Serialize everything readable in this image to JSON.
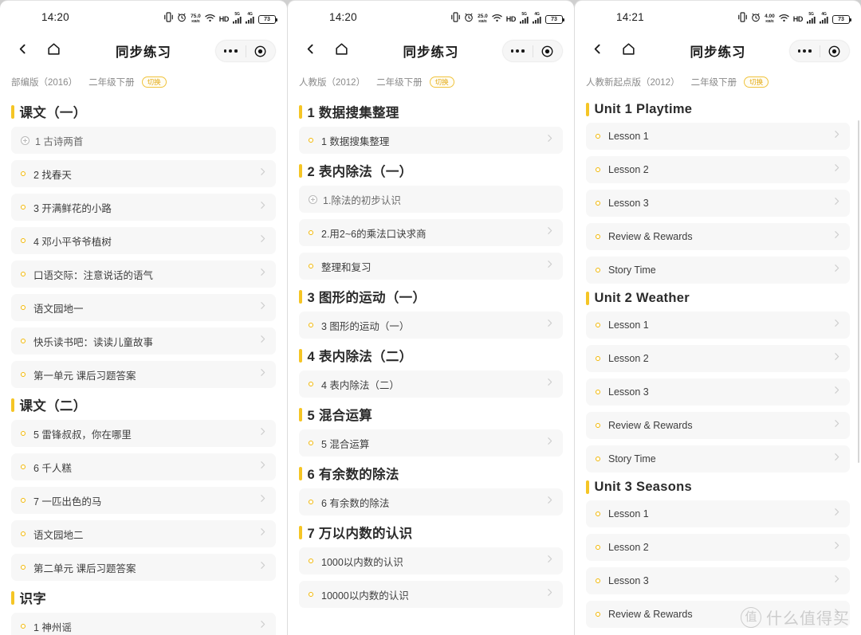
{
  "panels": [
    {
      "status": {
        "time": "14:20",
        "net_speed": "75.0",
        "net_unit": "KB/S",
        "hd_label": "HD",
        "signal1": "5G",
        "signal2": "4G",
        "battery": "73"
      },
      "nav": {
        "title": "同步练习",
        "back_icon": "chevron-left-icon",
        "home_icon": "home-icon",
        "more_icon": "more-dots-icon",
        "target_icon": "target-icon"
      },
      "meta": {
        "book": "部编版（2016）",
        "grade": "二年级下册",
        "switch_label": "切换"
      },
      "sections": [
        {
          "title": "课文（一）",
          "items": [
            {
              "label": "1 古诗两首",
              "state": "loading",
              "chevron": false
            },
            {
              "label": "2 找春天",
              "state": "normal",
              "chevron": true
            },
            {
              "label": "3 开满鲜花的小路",
              "state": "normal",
              "chevron": true
            },
            {
              "label": "4 邓小平爷爷植树",
              "state": "normal",
              "chevron": true
            },
            {
              "label": "口语交际：注意说话的语气",
              "state": "normal",
              "chevron": true
            },
            {
              "label": "语文园地一",
              "state": "normal",
              "chevron": true
            },
            {
              "label": "快乐读书吧：读读儿童故事",
              "state": "normal",
              "chevron": true
            },
            {
              "label": "第一单元 课后习题答案",
              "state": "normal",
              "chevron": true
            }
          ]
        },
        {
          "title": "课文（二）",
          "items": [
            {
              "label": "5 雷锋叔叔，你在哪里",
              "state": "normal",
              "chevron": true
            },
            {
              "label": "6 千人糕",
              "state": "normal",
              "chevron": true
            },
            {
              "label": "7 一匹出色的马",
              "state": "normal",
              "chevron": true
            },
            {
              "label": "语文园地二",
              "state": "normal",
              "chevron": true
            },
            {
              "label": "第二单元 课后习题答案",
              "state": "normal",
              "chevron": true
            }
          ]
        },
        {
          "title": "识字",
          "items": [
            {
              "label": "1 神州谣",
              "state": "normal",
              "chevron": true
            }
          ]
        }
      ]
    },
    {
      "status": {
        "time": "14:20",
        "net_speed": "25.0",
        "net_unit": "KB/S",
        "hd_label": "HD",
        "signal1": "5G",
        "signal2": "4G",
        "battery": "73"
      },
      "nav": {
        "title": "同步练习",
        "back_icon": "chevron-left-icon",
        "home_icon": "home-icon",
        "more_icon": "more-dots-icon",
        "target_icon": "target-icon"
      },
      "meta": {
        "book": "人教版（2012）",
        "grade": "二年级下册",
        "switch_label": "切换"
      },
      "sections": [
        {
          "title": "1 数据搜集整理",
          "items": [
            {
              "label": "1 数据搜集整理",
              "state": "normal",
              "chevron": true
            }
          ]
        },
        {
          "title": "2 表内除法（一）",
          "items": [
            {
              "label": "1.除法的初步认识",
              "state": "loading",
              "chevron": false
            },
            {
              "label": "2.用2~6的乘法口诀求商",
              "state": "normal",
              "chevron": true
            },
            {
              "label": "整理和复习",
              "state": "normal",
              "chevron": true
            }
          ]
        },
        {
          "title": "3 图形的运动（一）",
          "items": [
            {
              "label": "3 图形的运动（一）",
              "state": "normal",
              "chevron": true
            }
          ]
        },
        {
          "title": "4 表内除法（二）",
          "items": [
            {
              "label": "4 表内除法（二）",
              "state": "normal",
              "chevron": true
            }
          ]
        },
        {
          "title": "5 混合运算",
          "items": [
            {
              "label": "5 混合运算",
              "state": "normal",
              "chevron": true
            }
          ]
        },
        {
          "title": "6 有余数的除法",
          "items": [
            {
              "label": "6 有余数的除法",
              "state": "normal",
              "chevron": true
            }
          ]
        },
        {
          "title": "7 万以内数的认识",
          "items": [
            {
              "label": "1000以内数的认识",
              "state": "normal",
              "chevron": true
            },
            {
              "label": "10000以内数的认识",
              "state": "normal",
              "chevron": true
            }
          ]
        }
      ]
    },
    {
      "status": {
        "time": "14:21",
        "net_speed": "4.00",
        "net_unit": "KB/S",
        "hd_label": "HD",
        "signal1": "5G",
        "signal2": "4G",
        "battery": "73"
      },
      "nav": {
        "title": "同步练习",
        "back_icon": "chevron-left-icon",
        "home_icon": "home-icon",
        "more_icon": "more-dots-icon",
        "target_icon": "target-icon"
      },
      "meta": {
        "book": "人教新起点版（2012）",
        "grade": "二年级下册",
        "switch_label": "切换"
      },
      "sections": [
        {
          "title": "Unit 1 Playtime",
          "items": [
            {
              "label": "Lesson 1",
              "state": "normal",
              "chevron": true
            },
            {
              "label": "Lesson 2",
              "state": "normal",
              "chevron": true
            },
            {
              "label": "Lesson 3",
              "state": "normal",
              "chevron": true
            },
            {
              "label": "Review & Rewards",
              "state": "normal",
              "chevron": true
            },
            {
              "label": "Story Time",
              "state": "normal",
              "chevron": true
            }
          ]
        },
        {
          "title": "Unit 2 Weather",
          "items": [
            {
              "label": "Lesson 1",
              "state": "normal",
              "chevron": true
            },
            {
              "label": "Lesson 2",
              "state": "normal",
              "chevron": true
            },
            {
              "label": "Lesson 3",
              "state": "normal",
              "chevron": true
            },
            {
              "label": "Review & Rewards",
              "state": "normal",
              "chevron": true
            },
            {
              "label": "Story Time",
              "state": "normal",
              "chevron": true
            }
          ]
        },
        {
          "title": "Unit 3 Seasons",
          "items": [
            {
              "label": "Lesson 1",
              "state": "normal",
              "chevron": true
            },
            {
              "label": "Lesson 2",
              "state": "normal",
              "chevron": true
            },
            {
              "label": "Lesson 3",
              "state": "normal",
              "chevron": true
            },
            {
              "label": "Review & Rewards",
              "state": "normal",
              "chevron": true
            }
          ]
        }
      ]
    }
  ],
  "watermark": {
    "logo": "值",
    "text": "什么值得买"
  },
  "colors": {
    "accent": "#f5c525",
    "dot": "#f2b705",
    "row_bg": "#f7f7f7",
    "text": "#3d3d3d"
  }
}
